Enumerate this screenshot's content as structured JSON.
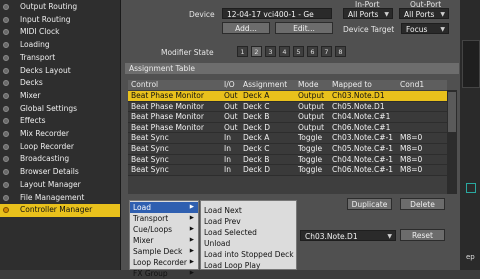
{
  "sidebar": {
    "items": [
      {
        "label": "Output Routing",
        "active": false
      },
      {
        "label": "Input Routing",
        "active": false
      },
      {
        "label": "MIDI Clock",
        "active": false
      },
      {
        "label": "Loading",
        "active": false
      },
      {
        "label": "Transport",
        "active": false
      },
      {
        "label": "Decks Layout",
        "active": false
      },
      {
        "label": "Decks",
        "active": false
      },
      {
        "label": "Mixer",
        "active": false
      },
      {
        "label": "Global Settings",
        "active": false
      },
      {
        "label": "Effects",
        "active": false
      },
      {
        "label": "Mix Recorder",
        "active": false
      },
      {
        "label": "Loop Recorder",
        "active": false
      },
      {
        "label": "Broadcasting",
        "active": false
      },
      {
        "label": "Browser Details",
        "active": false
      },
      {
        "label": "Layout Manager",
        "active": false
      },
      {
        "label": "File Management",
        "active": false
      },
      {
        "label": "Controller Manager",
        "active": true
      }
    ]
  },
  "device": {
    "label": "Device",
    "value": "12-04-17 vci400-1 - Ge",
    "add": "Add...",
    "edit": "Edit...",
    "in_port_header": "In-Port",
    "out_port_header": "Out-Port",
    "in_port_value": "All Ports",
    "out_port_value": "All Ports",
    "target_label": "Device Target",
    "target_value": "Focus"
  },
  "modifier": {
    "label": "Modifier State",
    "buttons": [
      "1",
      "2",
      "3",
      "4",
      "5",
      "6",
      "7",
      "8"
    ]
  },
  "assignment_table": {
    "title": "Assignment Table",
    "columns": [
      "Control",
      "I/O",
      "Assignment",
      "Mode",
      "Mapped to",
      "Cond1"
    ],
    "rows": [
      {
        "control": "Beat Phase Monitor",
        "io": "Out",
        "assignment": "Deck A",
        "mode": "Output",
        "mapped": "Ch03.Note.D1",
        "cond": "",
        "selected": true
      },
      {
        "control": "Beat Phase Monitor",
        "io": "Out",
        "assignment": "Deck C",
        "mode": "Output",
        "mapped": "Ch05.Note.D1",
        "cond": "",
        "selected": false
      },
      {
        "control": "Beat Phase Monitor",
        "io": "Out",
        "assignment": "Deck B",
        "mode": "Output",
        "mapped": "Ch04.Note.C#1",
        "cond": "",
        "selected": false
      },
      {
        "control": "Beat Phase Monitor",
        "io": "Out",
        "assignment": "Deck D",
        "mode": "Output",
        "mapped": "Ch06.Note.C#1",
        "cond": "",
        "selected": false
      },
      {
        "control": "Beat Sync",
        "io": "In",
        "assignment": "Deck A",
        "mode": "Toggle",
        "mapped": "Ch03.Note.C#-1",
        "cond": "M8=0",
        "selected": false
      },
      {
        "control": "Beat Sync",
        "io": "In",
        "assignment": "Deck C",
        "mode": "Toggle",
        "mapped": "Ch05.Note.C#-1",
        "cond": "M8=0",
        "selected": false
      },
      {
        "control": "Beat Sync",
        "io": "In",
        "assignment": "Deck B",
        "mode": "Toggle",
        "mapped": "Ch04.Note.C#-1",
        "cond": "M8=0",
        "selected": false
      },
      {
        "control": "Beat Sync",
        "io": "In",
        "assignment": "Deck D",
        "mode": "Toggle",
        "mapped": "Ch06.Note.C#-1",
        "cond": "M8=0",
        "selected": false
      }
    ],
    "duplicate": "Duplicate",
    "delete": "Delete"
  },
  "mapping": {
    "value": "Ch03.Note.D1",
    "reset": "Reset"
  },
  "menu_categories": [
    {
      "label": "Load",
      "highlighted": true
    },
    {
      "label": "Transport",
      "highlighted": false
    },
    {
      "label": "Cue/Loops",
      "highlighted": false
    },
    {
      "label": "Mixer",
      "highlighted": false
    },
    {
      "label": "Sample Deck",
      "highlighted": false
    },
    {
      "label": "Loop Recorder",
      "highlighted": false
    },
    {
      "label": "FX Group",
      "highlighted": false
    }
  ],
  "menu_load": [
    "Load Next",
    "Load Prev",
    "Load Selected",
    "Unload",
    "Load into Stopped Deck",
    "Load Loop Play"
  ],
  "right_strip": {
    "tail": "ep"
  }
}
